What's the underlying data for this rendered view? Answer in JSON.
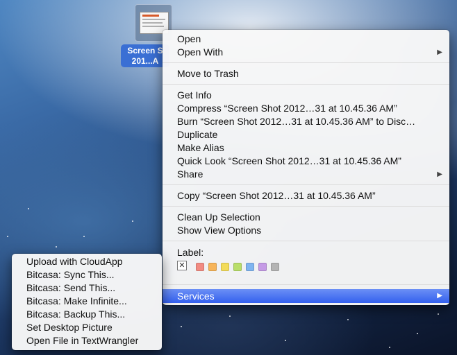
{
  "desktop": {
    "file_icon": {
      "label_line1": "Screen S",
      "label_line2": "201...A",
      "icon": "screenshot-file-icon"
    }
  },
  "context_menu": {
    "groups": [
      [
        {
          "label": "Open",
          "submenu": false
        },
        {
          "label": "Open With",
          "submenu": true
        }
      ],
      [
        {
          "label": "Move to Trash",
          "submenu": false
        }
      ],
      [
        {
          "label": "Get Info",
          "submenu": false
        },
        {
          "label": "Compress “Screen Shot 2012…31 at 10.45.36 AM”",
          "submenu": false
        },
        {
          "label": "Burn “Screen Shot 2012…31 at 10.45.36 AM” to Disc…",
          "submenu": false
        },
        {
          "label": "Duplicate",
          "submenu": false
        },
        {
          "label": "Make Alias",
          "submenu": false
        },
        {
          "label": "Quick Look “Screen Shot 2012…31 at 10.45.36 AM”",
          "submenu": false
        },
        {
          "label": "Share",
          "submenu": true
        }
      ],
      [
        {
          "label": "Copy “Screen Shot 2012…31 at 10.45.36 AM”",
          "submenu": false
        }
      ],
      [
        {
          "label": "Clean Up Selection",
          "submenu": false
        },
        {
          "label": "Show View Options",
          "submenu": false
        }
      ]
    ],
    "label_section": {
      "heading": "Label:",
      "none_glyph": "✕",
      "colors": [
        "#f28b82",
        "#f7b55a",
        "#f3dc5a",
        "#b9de6a",
        "#7fb4f0",
        "#c59be6",
        "#b4b4b4"
      ]
    },
    "services": {
      "label": "Services",
      "submenu": true,
      "highlighted": true
    },
    "submenu_arrow": "▶"
  },
  "services_menu": {
    "items": [
      "Upload with CloudApp",
      "Bitcasa: Sync This...",
      "Bitcasa: Send This...",
      "Bitcasa: Make Infinite...",
      "Bitcasa: Backup This...",
      "Set Desktop Picture",
      "Open File in TextWrangler"
    ]
  }
}
